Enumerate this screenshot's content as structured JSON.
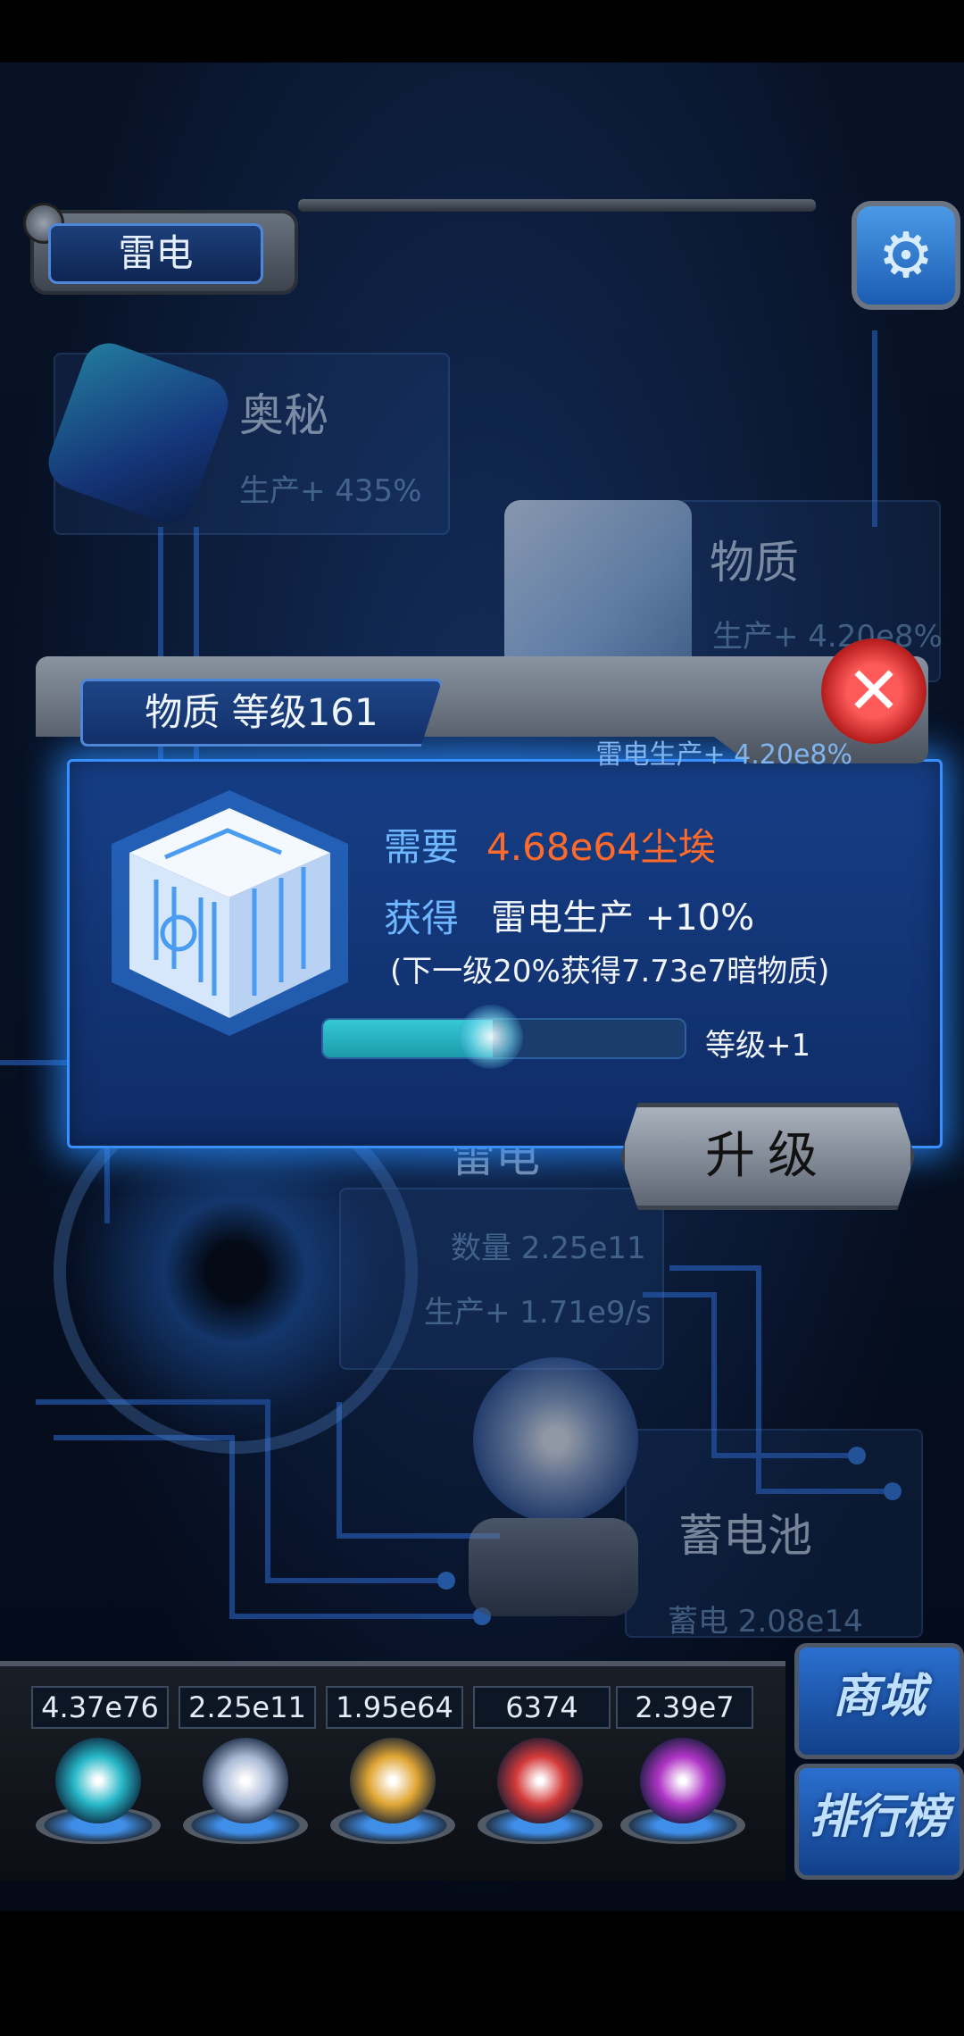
{
  "world": {
    "label": "雷电"
  },
  "settings": {
    "icon": "gear-icon"
  },
  "map_nodes": {
    "mystery": {
      "title": "奥秘",
      "subtitle": "生产+ 435%"
    },
    "matter": {
      "title": "物质",
      "subtitle": "生产+ 4.20e8%"
    },
    "thunder": {
      "title": "雷电",
      "count": "数量 2.25e11",
      "production": "生产+ 1.71e9/s"
    },
    "battery": {
      "title": "蓄电池",
      "subtitle": "蓄电 2.08e14"
    }
  },
  "modal": {
    "title": "物质 等级161",
    "subtitle": "雷电生产+ 4.20e8%",
    "require_label": "需要",
    "require_value": "4.68e64尘埃",
    "gain_label": "获得",
    "gain_value": "雷电生产 +10%",
    "next_info": "(下一级20%获得7.73e7暗物质)",
    "level_increment_label": "等级+1",
    "level_increment_fraction": 0.47,
    "upgrade_label": "升级",
    "close_icon": "close-icon"
  },
  "dock": {
    "resources": [
      {
        "value": "4.37e76",
        "icon": "atom-orb-icon",
        "color": "#27b8c8"
      },
      {
        "value": "2.25e11",
        "icon": "lightning-orb-icon",
        "color": "#a9b9d6"
      },
      {
        "value": "1.95e64",
        "icon": "dust-orb-icon",
        "color": "#e0a634"
      },
      {
        "value": "6374",
        "icon": "red-matter-orb-icon",
        "color": "#d43a3a"
      },
      {
        "value": "2.39e7",
        "icon": "dark-matter-orb-icon",
        "color": "#b035c6"
      }
    ],
    "shop_label": "商城",
    "ranking_label": "排行榜"
  },
  "colors": {
    "accent_blue": "#3a8fff",
    "require_orange": "#ff6a2a",
    "label_blue": "#6fb7ff"
  }
}
